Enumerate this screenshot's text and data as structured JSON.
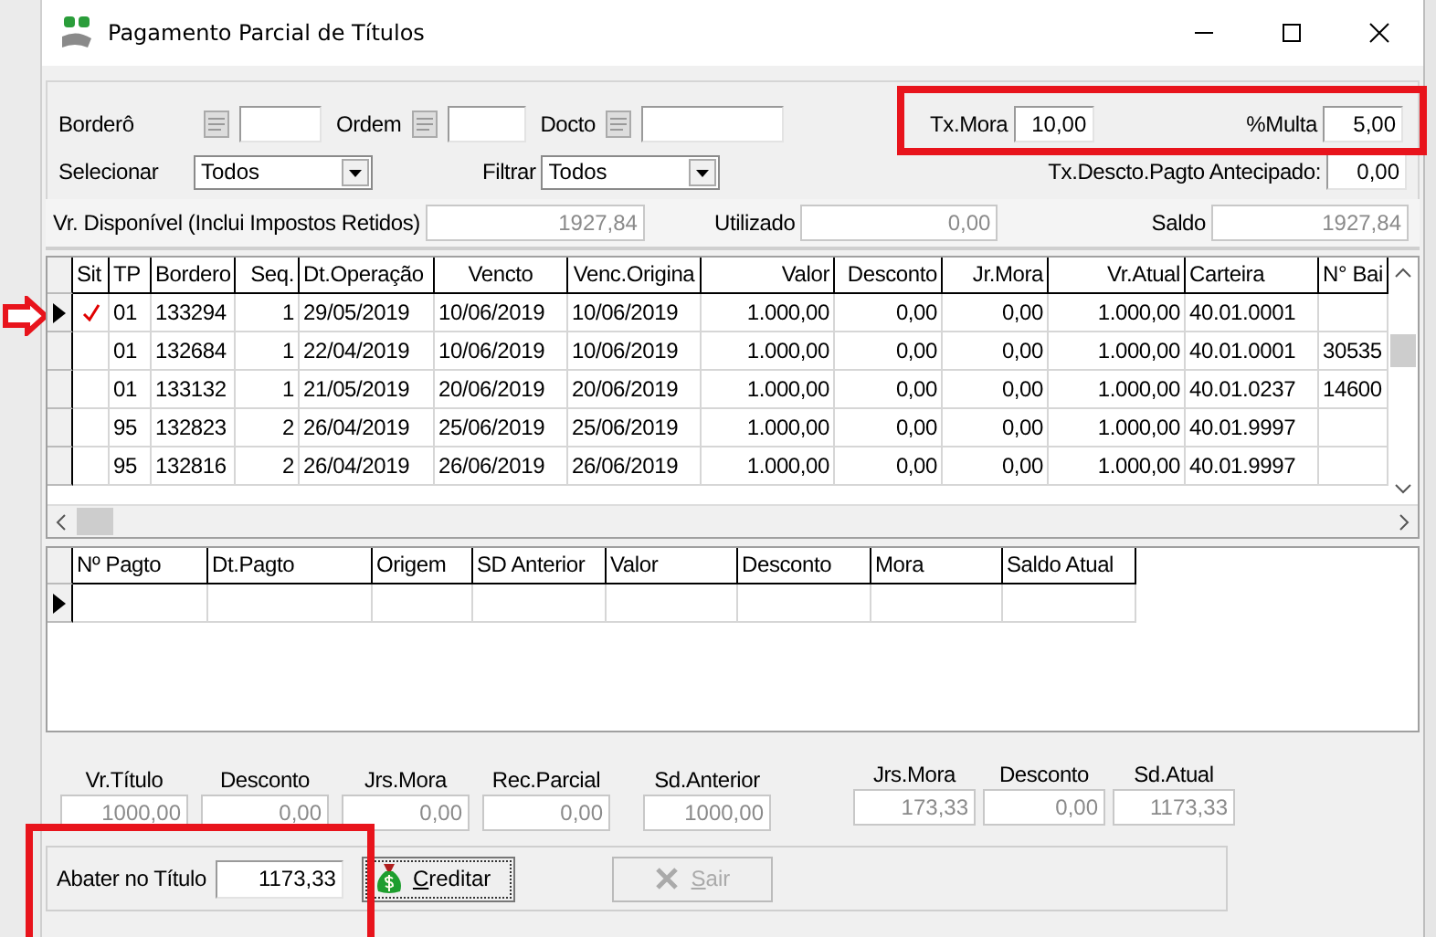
{
  "window": {
    "title": "Pagamento Parcial de Títulos"
  },
  "filters": {
    "bordero_label": "Borderô",
    "ordem_label": "Ordem",
    "docto_label": "Docto",
    "tx_mora": {
      "label": "Tx.Mora",
      "value": "10,00",
      "disabled": false
    },
    "multa": {
      "label": "%Multa",
      "value": "5,00",
      "disabled": false
    },
    "selecionar": {
      "label": "Selecionar",
      "value": "Todos"
    },
    "filtrar": {
      "label": "Filtrar",
      "value": "Todos"
    },
    "tx_descto": {
      "label": "Tx.Descto.Pagto Antecipado:",
      "value": "0,00",
      "disabled": false
    },
    "vr_disponivel": {
      "label": "Vr. Disponível (Inclui Impostos Retidos)",
      "value": "1927,84",
      "disabled": true
    },
    "utilizado": {
      "label": "Utilizado",
      "value": "0,00",
      "disabled": true
    },
    "saldo": {
      "label": "Saldo",
      "value": "1927,84",
      "disabled": true
    }
  },
  "titles_table": {
    "columns": [
      {
        "label": "Sit",
        "kind": "text"
      },
      {
        "label": "TP",
        "kind": "text"
      },
      {
        "label": "Bordero",
        "kind": "text"
      },
      {
        "label": "Seq.",
        "kind": "number"
      },
      {
        "label": "Dt.Operação",
        "kind": "text"
      },
      {
        "label": "Vencto",
        "kind": "date"
      },
      {
        "label": "Venc.Origina",
        "kind": "date"
      },
      {
        "label": "Valor",
        "kind": "number"
      },
      {
        "label": "Desconto",
        "kind": "number"
      },
      {
        "label": "Jr.Mora",
        "kind": "number"
      },
      {
        "label": "Vr.Atual",
        "kind": "number"
      },
      {
        "label": "Carteira",
        "kind": "text"
      },
      {
        "label": "N° Bai",
        "kind": "text"
      }
    ],
    "rows": [
      {
        "selected": true,
        "checked": true,
        "cells": [
          "",
          "01",
          "133294",
          "1",
          "29/05/2019",
          "10/06/2019",
          "10/06/2019",
          "1.000,00",
          "0,00",
          "0,00",
          "1.000,00",
          "40.01.0001",
          ""
        ]
      },
      {
        "selected": false,
        "checked": false,
        "cells": [
          "",
          "01",
          "132684",
          "1",
          "22/04/2019",
          "10/06/2019",
          "10/06/2019",
          "1.000,00",
          "0,00",
          "0,00",
          "1.000,00",
          "40.01.0001",
          "30535"
        ]
      },
      {
        "selected": false,
        "checked": false,
        "cells": [
          "",
          "01",
          "133132",
          "1",
          "21/05/2019",
          "20/06/2019",
          "20/06/2019",
          "1.000,00",
          "0,00",
          "0,00",
          "1.000,00",
          "40.01.0237",
          "14600"
        ]
      },
      {
        "selected": false,
        "checked": false,
        "cells": [
          "",
          "95",
          "132823",
          "2",
          "26/04/2019",
          "25/06/2019",
          "25/06/2019",
          "1.000,00",
          "0,00",
          "0,00",
          "1.000,00",
          "40.01.9997",
          ""
        ]
      },
      {
        "selected": false,
        "checked": false,
        "cells": [
          "",
          "95",
          "132816",
          "2",
          "26/04/2019",
          "26/06/2019",
          "26/06/2019",
          "1.000,00",
          "0,00",
          "0,00",
          "1.000,00",
          "40.01.9997",
          ""
        ]
      }
    ]
  },
  "payments_table": {
    "columns": [
      "Nº Pagto",
      "Dt.Pagto",
      "Origem",
      "SD Anterior",
      "Valor",
      "Desconto",
      "Mora",
      "Saldo Atual"
    ],
    "rows": [
      {
        "selected": true
      }
    ]
  },
  "summary_left": [
    {
      "label": "Vr.Título",
      "value": "1000,00",
      "disabled": true
    },
    {
      "label": "Desconto",
      "value": "0,00",
      "disabled": true
    },
    {
      "label": "Jrs.Mora",
      "value": "0,00",
      "disabled": true
    },
    {
      "label": "Rec.Parcial",
      "value": "0,00",
      "disabled": true
    },
    {
      "label": "Sd.Anterior",
      "value": "1000,00",
      "disabled": true
    }
  ],
  "summary_right": [
    {
      "label": "Jrs.Mora",
      "value": "173,33",
      "disabled": true
    },
    {
      "label": "Desconto",
      "value": "0,00",
      "disabled": true
    },
    {
      "label": "Sd.Atual",
      "value": "1173,33",
      "disabled": true
    }
  ],
  "abater": {
    "label": "Abater no Título",
    "value": "1173,33",
    "disabled": false
  },
  "buttons": [
    {
      "label": "Creditar",
      "disabled": false,
      "kind": "credit"
    },
    {
      "label": "Sair",
      "disabled": true,
      "kind": "exit"
    }
  ]
}
